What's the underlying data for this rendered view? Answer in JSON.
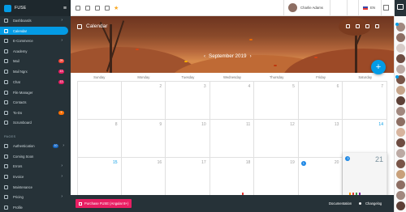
{
  "sidebar": {
    "app_title": "FUSE",
    "section_pages": "PAGES",
    "items": [
      {
        "label": "Dashboards",
        "arrow": "›",
        "active": false
      },
      {
        "label": "Calendar",
        "active": true
      },
      {
        "label": "E-Commerce",
        "arrow": "›"
      },
      {
        "label": "Academy"
      },
      {
        "label": "Mail",
        "badge": "25",
        "badge_color": "#f44336"
      },
      {
        "label": "Mail Ngrx",
        "badge": "13",
        "badge_color": "#e91e63"
      },
      {
        "label": "Chat",
        "badge": "13",
        "badge_color": "#e91e63"
      },
      {
        "label": "File Manager"
      },
      {
        "label": "Contacts"
      },
      {
        "label": "To-Do",
        "badge": "3",
        "badge_color": "#ff6f00"
      },
      {
        "label": "Scrumboard"
      },
      {
        "label": "Authentication",
        "badge": "10",
        "badge_color": "#1565c0",
        "arrow": "›"
      },
      {
        "label": "Coming Soon"
      },
      {
        "label": "Errors",
        "arrow": "›"
      },
      {
        "label": "Invoice",
        "arrow": "›"
      },
      {
        "label": "Maintenance"
      },
      {
        "label": "Pricing",
        "arrow": "›"
      },
      {
        "label": "Profile"
      }
    ]
  },
  "topbar": {
    "user_name": "Charlie Adams",
    "language": "EN"
  },
  "calendar": {
    "title": "Calendar",
    "month_label": "September 2019",
    "prev": "‹",
    "next": "›",
    "weekdays": [
      "Sunday",
      "Monday",
      "Tuesday",
      "Wednesday",
      "Thursday",
      "Friday",
      "Saturday"
    ],
    "weeks": [
      [
        "",
        "2",
        "3",
        "4",
        "5",
        "6",
        "7"
      ],
      [
        "8",
        "9",
        "10",
        "11",
        "12",
        "13",
        "14"
      ],
      [
        "15",
        "16",
        "17",
        "18",
        "19",
        "20",
        "21"
      ]
    ],
    "blue_days": [
      "14",
      "15",
      "21"
    ],
    "today": "21",
    "event_badges": {
      "20": "1",
      "21": "3"
    }
  },
  "fab_label": "+",
  "bottombar": {
    "purchase_label": "Purchase FUSE (Angular 8+)",
    "documentation": "Documentation",
    "changelog": "Changelog"
  },
  "colors": {
    "accent": "#039be5",
    "sidebar_bg": "#263238",
    "purchase": "#e91e63"
  },
  "icons": {
    "menu": "menu-icon",
    "star": "star-icon",
    "add": "add-icon"
  }
}
